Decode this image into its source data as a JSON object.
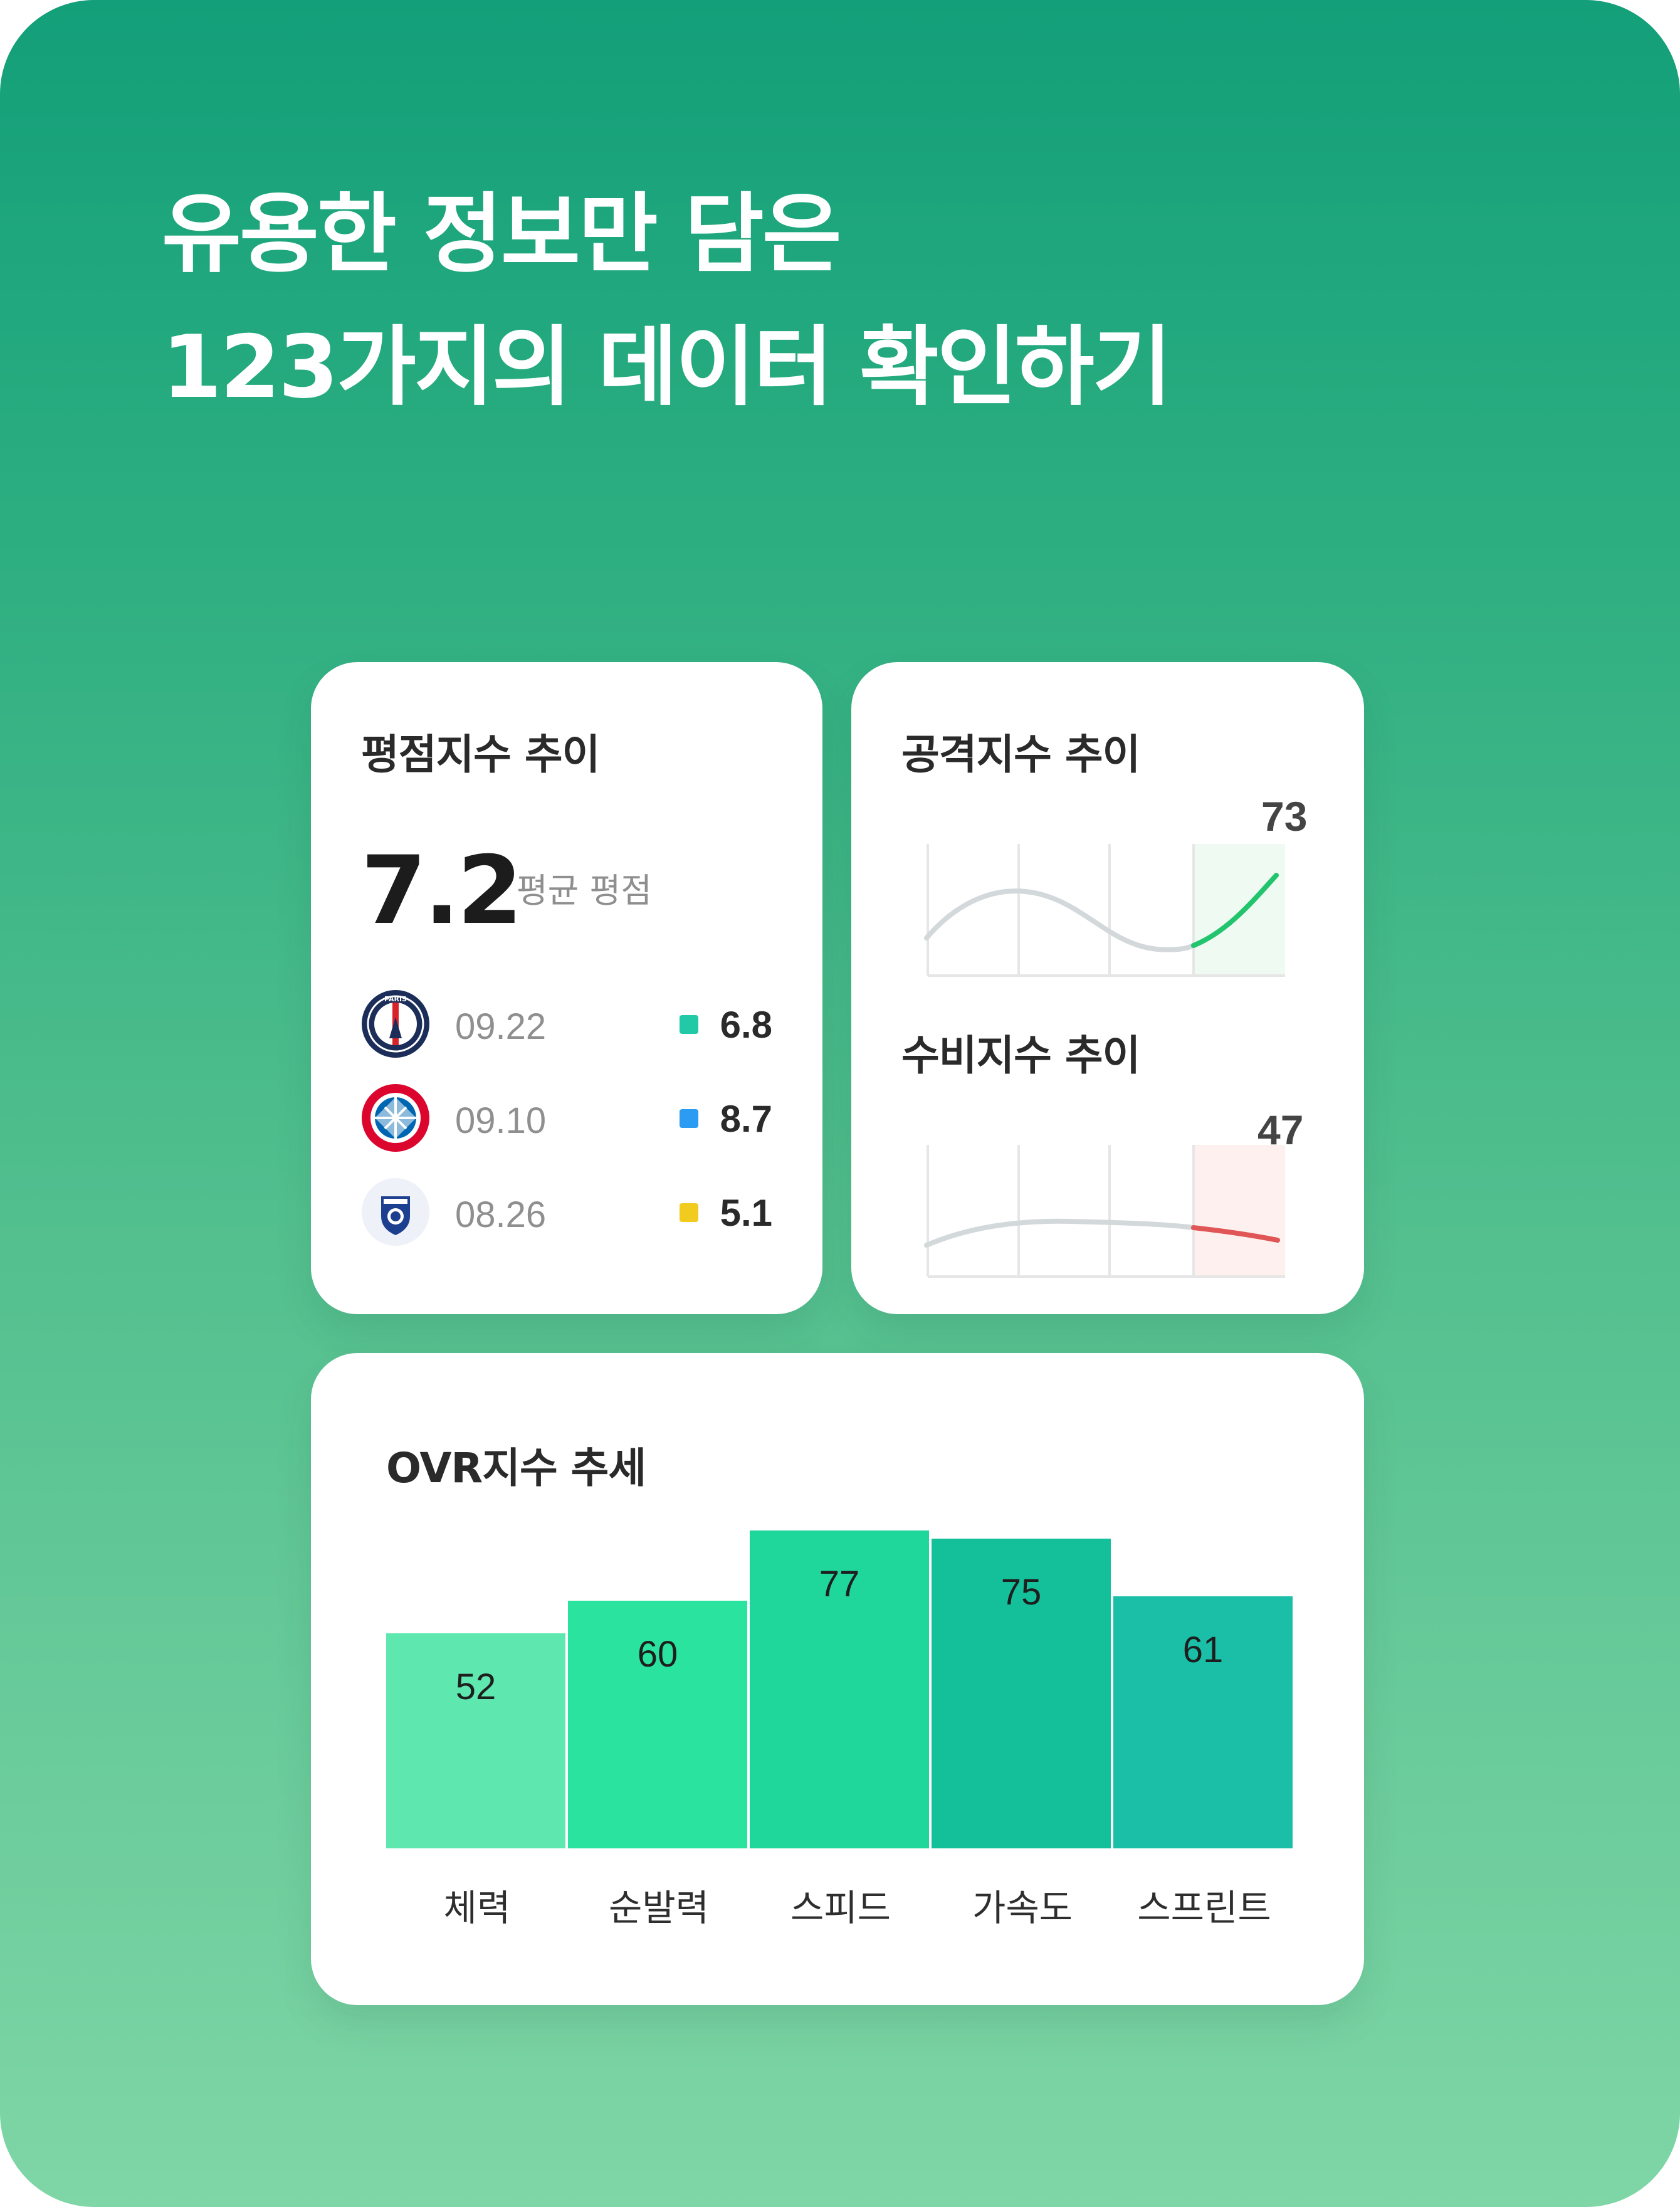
{
  "headline": {
    "line1": "유용한 정보만 담은",
    "line2": "123가지의 데이터 확인하기"
  },
  "rating_card": {
    "title": "평점지수 추이",
    "average_value": "7.2",
    "average_label": "평균 평점",
    "matches": [
      {
        "team_icon": "psg-logo-icon",
        "date": "09.22",
        "score": "6.8",
        "marker_color": "#22c9a6"
      },
      {
        "team_icon": "bayern-logo-icon",
        "date": "09.10",
        "score": "8.7",
        "marker_color": "#2b9cf2"
      },
      {
        "team_icon": "ulsan-logo-icon",
        "date": "08.26",
        "score": "5.1",
        "marker_color": "#f1cc1f"
      }
    ]
  },
  "trend_card": {
    "attack": {
      "title": "공격지수 추이",
      "latest_value": "73",
      "line_color": "#22c56e",
      "highlight_color": "#eefaf2"
    },
    "defense": {
      "title": "수비지수 추이",
      "latest_value": "47",
      "line_color": "#e05656",
      "highlight_color": "#fdf0ee"
    }
  },
  "ovr_card": {
    "title": "OVR지수 추세"
  },
  "chart_data": {
    "type": "bar",
    "title": "OVR지수 추세",
    "categories": [
      "체력",
      "순발력",
      "스피드",
      "가속도",
      "스프린트"
    ],
    "values": [
      52,
      60,
      77,
      75,
      61
    ],
    "colors": [
      "#5ee8b0",
      "#2ae39e",
      "#1fd69b",
      "#14c09a",
      "#1bbfa8"
    ],
    "ylim": [
      0,
      85
    ],
    "data_labels": [
      "52",
      "60",
      "77",
      "75",
      "61"
    ]
  }
}
